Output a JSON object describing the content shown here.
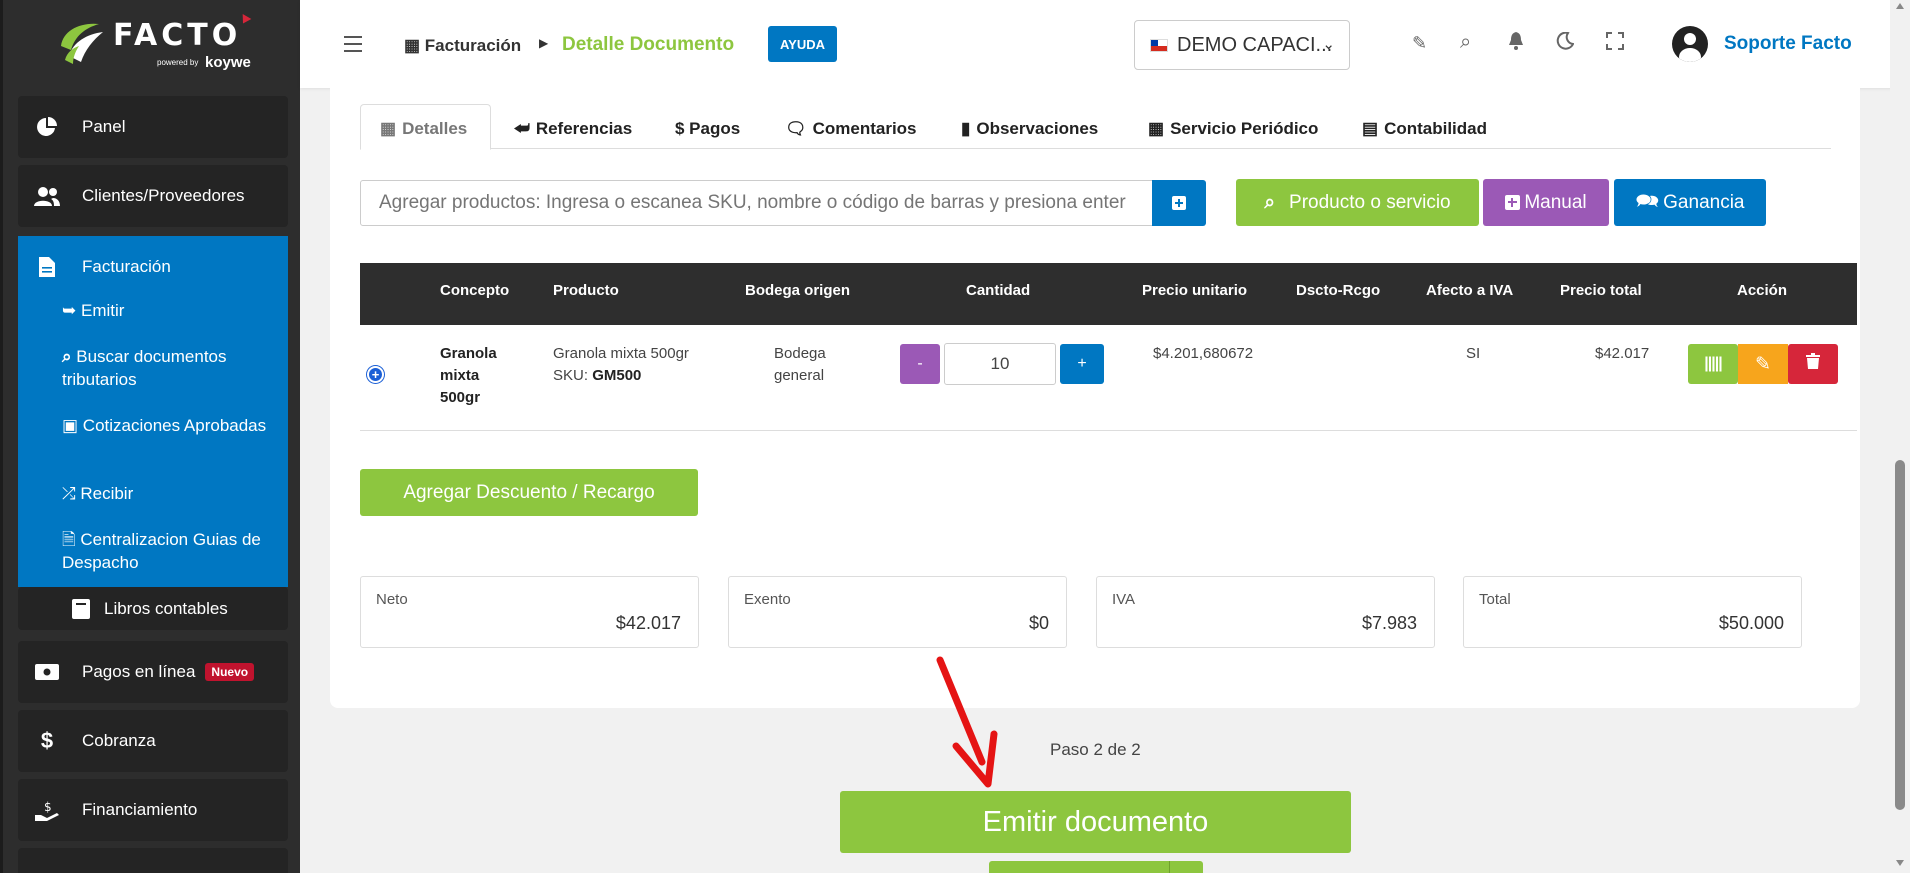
{
  "brand": {
    "name": "FACTO",
    "powered": "powered by",
    "by": "koywe"
  },
  "sidebar": {
    "panel": "Panel",
    "clientes": "Clientes/Proveedores",
    "facturacion": "Facturación",
    "emitir": "Emitir",
    "buscar": "Buscar documentos tributarios",
    "cotizaciones": "Cotizaciones Aprobadas",
    "recibir": "Recibir",
    "centralizacion": "Centralizacion Guias de Despacho",
    "libros": "Libros contables",
    "pagos": "Pagos en línea",
    "pagos_badge": "Nuevo",
    "cobranza": "Cobranza",
    "financiamiento": "Financiamiento"
  },
  "header": {
    "crumb_root": "Facturación",
    "crumb_current": "Detalle Documento",
    "ayuda": "AYUDA",
    "company": "DEMO CAPACI...",
    "user": "Soporte Facto"
  },
  "tabs": [
    "Detalles",
    "Referencias",
    "$ Pagos",
    "Comentarios",
    "Observaciones",
    "Servicio Periódico",
    "Contabilidad"
  ],
  "search": {
    "placeholder": "Agregar productos: Ingresa o escanea SKU, nombre o código de barras y presiona enter"
  },
  "buttons": {
    "producto": "Producto o servicio",
    "manual": "Manual",
    "ganancia": "Ganancia",
    "descuento": "Agregar Descuento / Recargo",
    "emitir": "Emitir documento"
  },
  "table": {
    "headers": [
      "Concepto",
      "Producto",
      "Bodega origen",
      "Cantidad",
      "Precio unitario",
      "Dscto-Rcgo",
      "Afecto a IVA",
      "Precio total",
      "Acción"
    ],
    "row": {
      "concepto": "Granola mixta 500gr",
      "producto": "Granola mixta 500gr",
      "sku_label": "SKU:",
      "sku": "GM500",
      "bodega": "Bodega general",
      "cantidad": "10",
      "minus": "-",
      "plus": "+",
      "precio_unitario": "$4.201,680672",
      "dscto": "",
      "afecto": "SI",
      "precio_total": "$42.017"
    }
  },
  "totals": [
    {
      "label": "Neto",
      "value": "$42.017"
    },
    {
      "label": "Exento",
      "value": "$0"
    },
    {
      "label": "IVA",
      "value": "$7.983"
    },
    {
      "label": "Total",
      "value": "$50.000"
    }
  ],
  "paso": "Paso 2 de 2",
  "colors": {
    "sidebar": "#2d2d2d",
    "active": "#0077c2",
    "green": "#8dc63f",
    "purple": "#9b59b6",
    "blue": "#0077c2",
    "orange": "#f7a51c",
    "red": "#d6263a",
    "dark": "#2e2e2e"
  }
}
